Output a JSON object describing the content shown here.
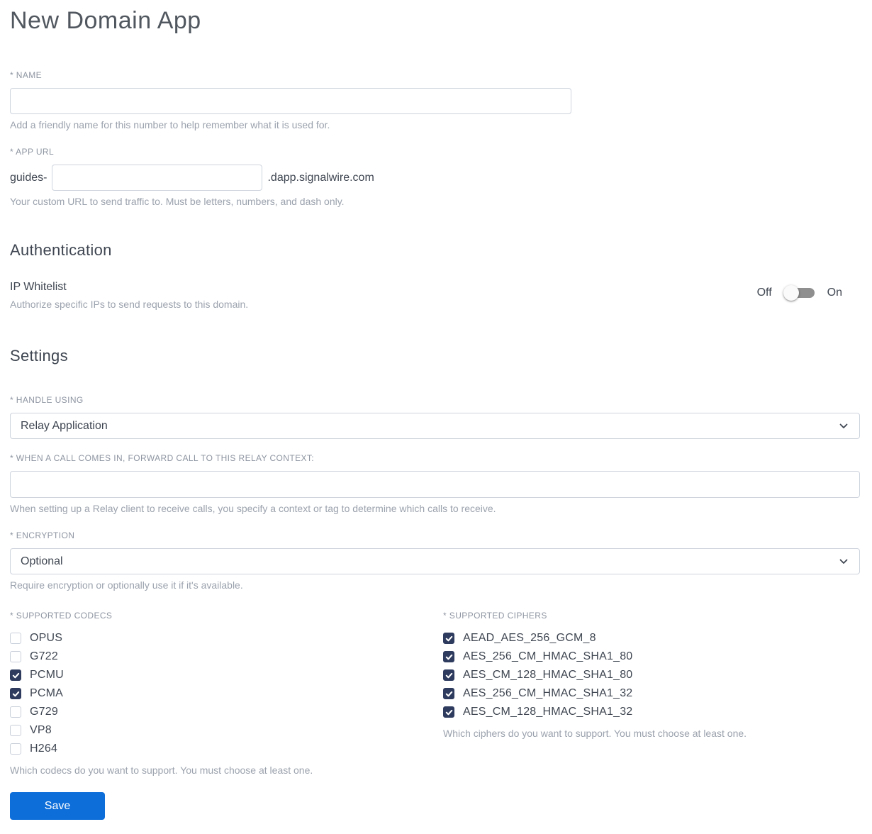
{
  "page": {
    "title": "New Domain App"
  },
  "name_field": {
    "label": "* NAME",
    "value": "",
    "helper": "Add a friendly name for this number to help remember what it is used for."
  },
  "app_url_field": {
    "label": "* APP URL",
    "prefix": "guides-",
    "value": "",
    "suffix": ".dapp.signalwire.com",
    "helper": "Your custom URL to send traffic to. Must be letters, numbers, and dash only."
  },
  "authentication": {
    "heading": "Authentication",
    "ip_whitelist": {
      "label": "IP Whitelist",
      "helper": "Authorize specific IPs to send requests to this domain.",
      "toggle_off_label": "Off",
      "toggle_on_label": "On",
      "state": "off"
    }
  },
  "settings": {
    "heading": "Settings",
    "handle_using": {
      "label": "* HANDLE USING",
      "selected": "Relay Application"
    },
    "relay_context": {
      "label": "* WHEN A CALL COMES IN, FORWARD CALL TO THIS RELAY CONTEXT:",
      "value": "",
      "helper": "When setting up a Relay client to receive calls, you specify a context or tag to determine which calls to receive."
    },
    "encryption": {
      "label": "* ENCRYPTION",
      "selected": "Optional",
      "helper": "Require encryption or optionally use it if it's available."
    },
    "codecs": {
      "label": "* SUPPORTED CODECS",
      "options": [
        {
          "label": "OPUS",
          "checked": false
        },
        {
          "label": "G722",
          "checked": false
        },
        {
          "label": "PCMU",
          "checked": true
        },
        {
          "label": "PCMA",
          "checked": true
        },
        {
          "label": "G729",
          "checked": false
        },
        {
          "label": "VP8",
          "checked": false
        },
        {
          "label": "H264",
          "checked": false
        }
      ],
      "helper": "Which codecs do you want to support. You must choose at least one."
    },
    "ciphers": {
      "label": "* SUPPORTED CIPHERS",
      "options": [
        {
          "label": "AEAD_AES_256_GCM_8",
          "checked": true
        },
        {
          "label": "AES_256_CM_HMAC_SHA1_80",
          "checked": true
        },
        {
          "label": "AES_CM_128_HMAC_SHA1_80",
          "checked": true
        },
        {
          "label": "AES_256_CM_HMAC_SHA1_32",
          "checked": true
        },
        {
          "label": "AES_CM_128_HMAC_SHA1_32",
          "checked": true
        }
      ],
      "helper": "Which ciphers do you want to support. You must choose at least one."
    }
  },
  "actions": {
    "save_label": "Save"
  },
  "colors": {
    "accent_blue": "#0d6dd9",
    "checkbox_checked": "#2e3b5e",
    "toggle_track": "#8f8f8f"
  }
}
